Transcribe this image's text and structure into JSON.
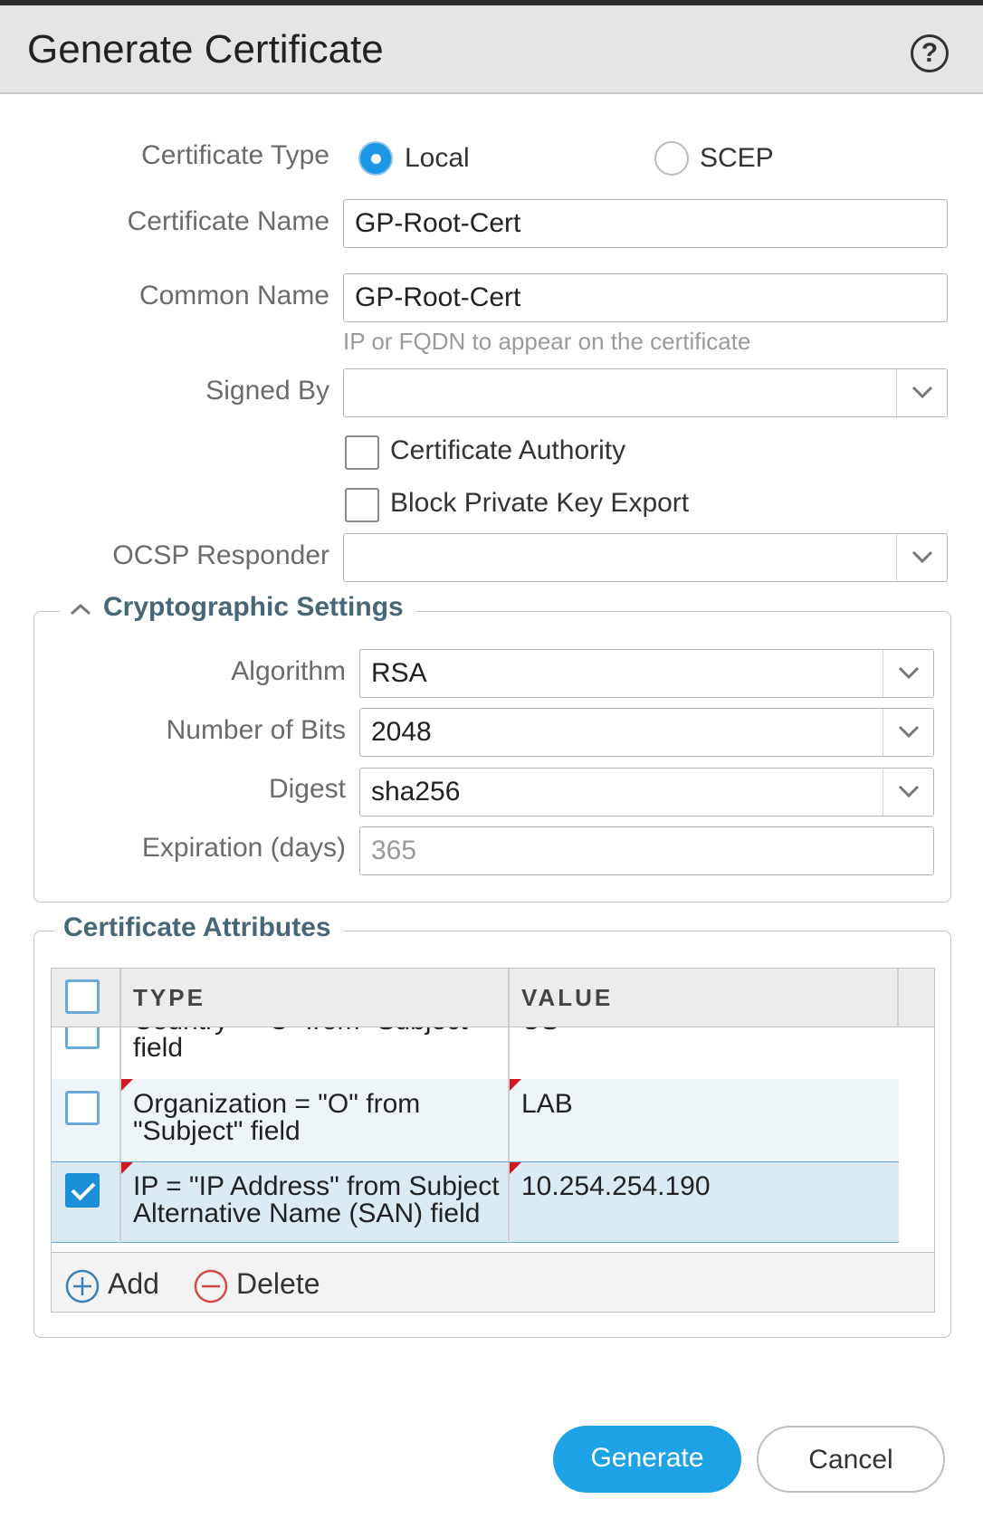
{
  "dialog": {
    "title": "Generate Certificate",
    "help_icon": "help-circle-icon"
  },
  "form": {
    "certificate_type": {
      "label": "Certificate Type",
      "options": [
        "Local",
        "SCEP"
      ],
      "selected": "Local"
    },
    "certificate_name": {
      "label": "Certificate Name",
      "value": "GP-Root-Cert"
    },
    "common_name": {
      "label": "Common Name",
      "value": "GP-Root-Cert",
      "hint": "IP or FQDN to appear on the certificate"
    },
    "signed_by": {
      "label": "Signed By",
      "value": ""
    },
    "certificate_authority": {
      "label": "Certificate Authority",
      "checked": false
    },
    "block_private_key_export": {
      "label": "Block Private Key Export",
      "checked": false
    },
    "ocsp_responder": {
      "label": "OCSP Responder",
      "value": ""
    }
  },
  "crypto": {
    "legend": "Cryptographic Settings",
    "algorithm": {
      "label": "Algorithm",
      "value": "RSA"
    },
    "bits": {
      "label": "Number of Bits",
      "value": "2048"
    },
    "digest": {
      "label": "Digest",
      "value": "sha256"
    },
    "expiration": {
      "label": "Expiration (days)",
      "placeholder": "365"
    }
  },
  "attributes": {
    "legend": "Certificate Attributes",
    "columns": {
      "type": "TYPE",
      "value": "VALUE"
    },
    "rows": [
      {
        "type_lines": [
          "Country = \"C\" from \"Subject\"",
          "field"
        ],
        "value": "US",
        "checked": false
      },
      {
        "type_lines": [
          "Organization = \"O\" from",
          "\"Subject\" field"
        ],
        "value": "LAB",
        "checked": false
      },
      {
        "type_lines": [
          "IP = \"IP Address\" from Subject",
          "Alternative Name (SAN) field"
        ],
        "value": "10.254.254.190",
        "checked": true
      }
    ],
    "add_label": "Add",
    "delete_label": "Delete"
  },
  "buttons": {
    "generate": "Generate",
    "cancel": "Cancel"
  },
  "colors": {
    "accent": "#1ea2e6",
    "row_bg": "#eef5f9",
    "row_selected": "#dceaf3",
    "legend": "#476778"
  }
}
